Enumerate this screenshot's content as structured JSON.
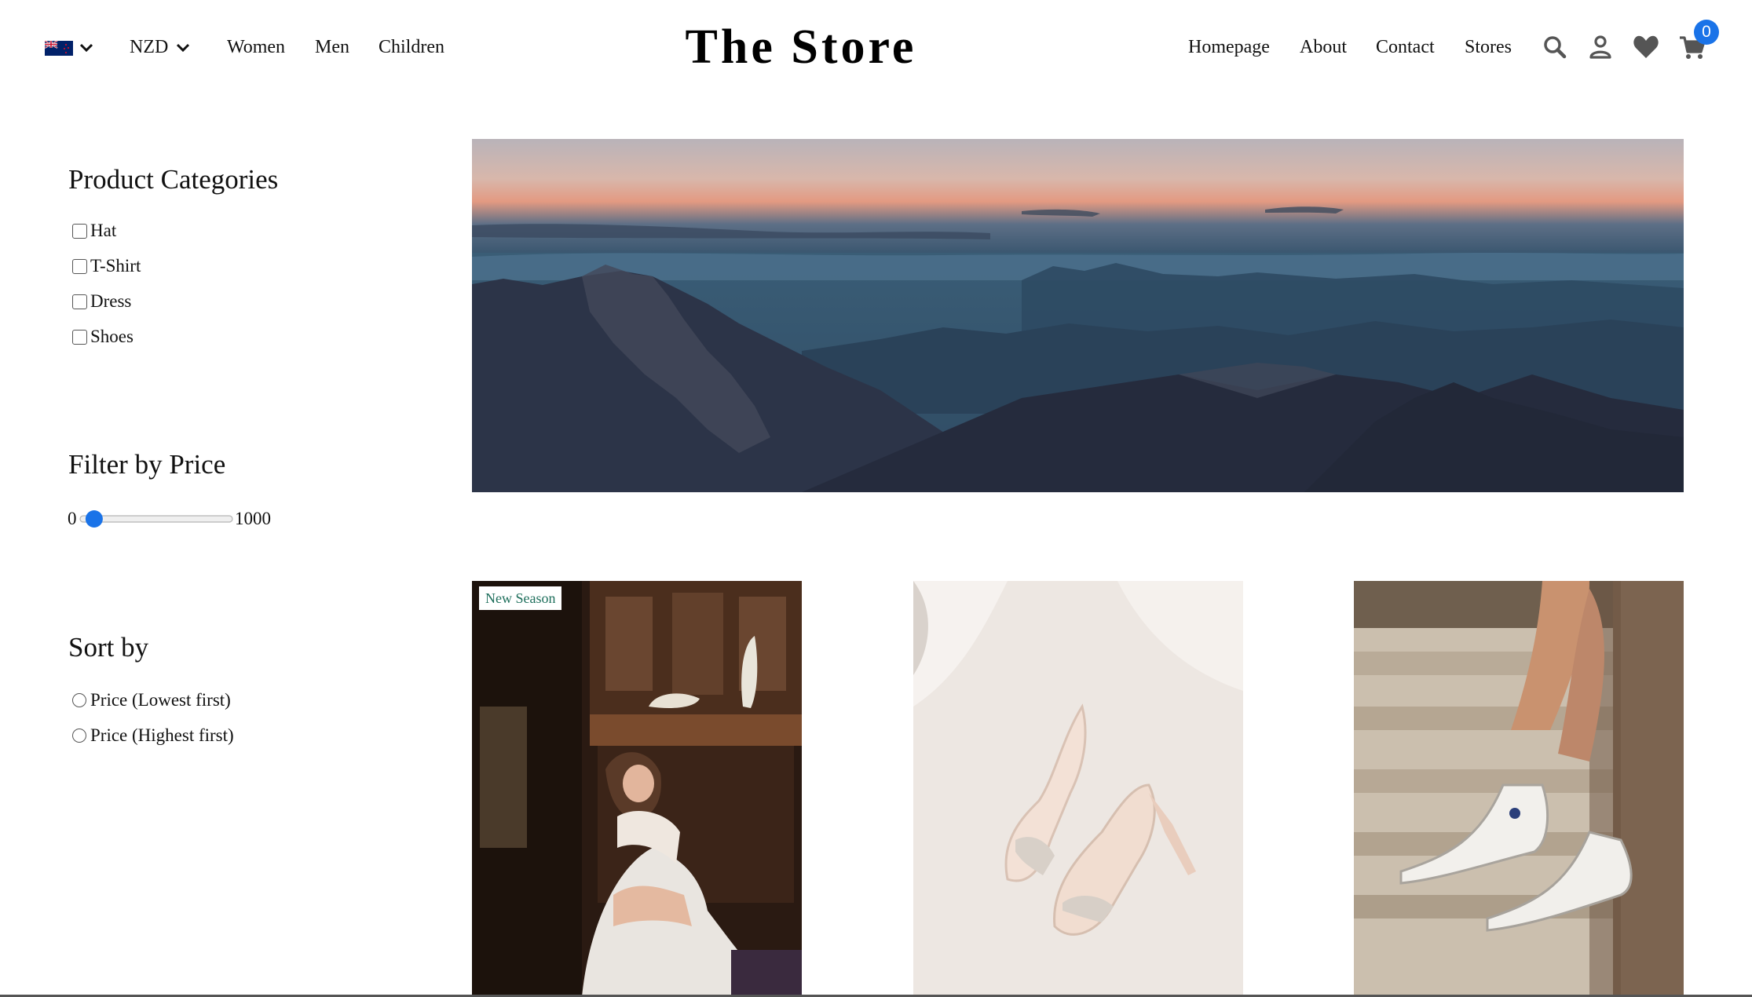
{
  "header": {
    "brand": "The Store",
    "currency": "NZD",
    "nav_left": [
      "Women",
      "Men",
      "Children"
    ],
    "nav_right": [
      "Homepage",
      "About",
      "Contact",
      "Stores"
    ],
    "cart_count": "0",
    "icons": [
      "nz-flag-icon",
      "chevron-down-icon",
      "search-icon",
      "user-icon",
      "heart-icon",
      "cart-icon"
    ],
    "accent_color": "#1a73e8"
  },
  "sidebar": {
    "categories": {
      "title": "Product Categories",
      "items": [
        "Hat",
        "T-Shirt",
        "Dress",
        "Shoes"
      ]
    },
    "price_filter": {
      "title": "Filter by Price",
      "min_label": "0",
      "max_label": "1000",
      "value_fraction": 0.04
    },
    "sort": {
      "title": "Sort by",
      "options": [
        "Price (Lowest first)",
        "Price (Highest first)"
      ]
    }
  },
  "products": [
    {
      "badge": "New Season",
      "image": "woman in white dress seated in antique room"
    },
    {
      "image": "white strappy high-heel sandals on tulle"
    },
    {
      "image": "legs wearing white high-top sneakers"
    }
  ],
  "hero": {
    "image": "mountain range at dusk above clouds"
  }
}
